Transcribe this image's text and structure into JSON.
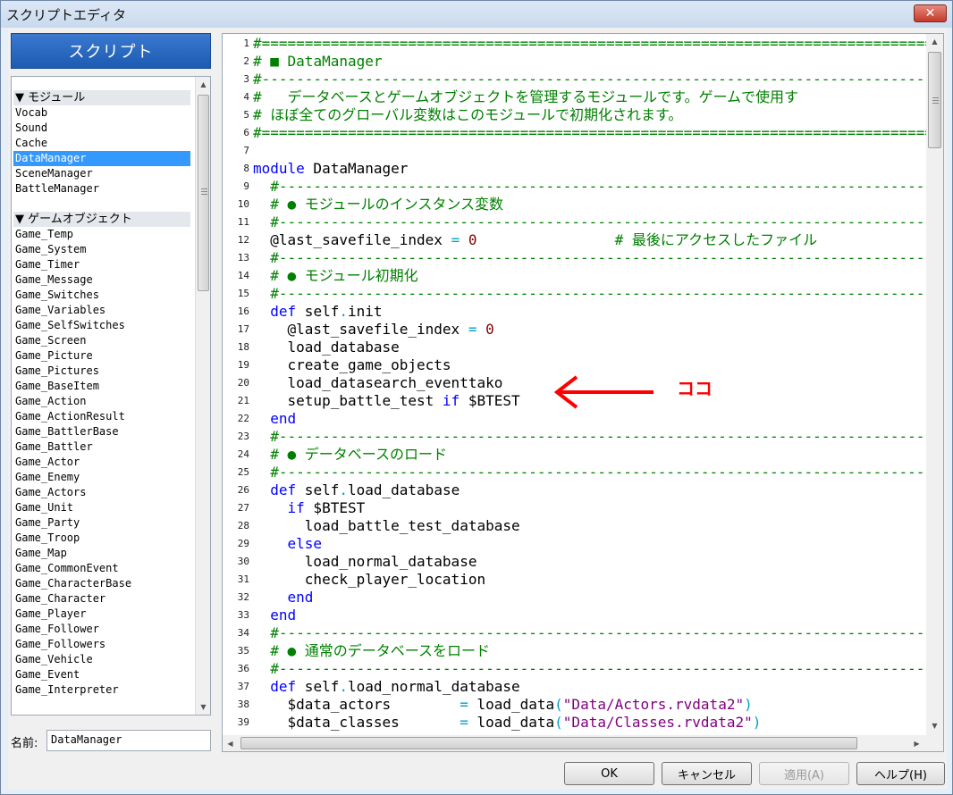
{
  "window": {
    "title": "スクリプトエディタ",
    "close_glyph": "✕"
  },
  "left_panel": {
    "header": "スクリプト",
    "items": [
      {
        "label": "▼ モジュール",
        "kind": "section"
      },
      {
        "label": "Vocab"
      },
      {
        "label": "Sound"
      },
      {
        "label": "Cache"
      },
      {
        "label": "DataManager",
        "selected": true
      },
      {
        "label": "SceneManager"
      },
      {
        "label": "BattleManager"
      },
      {
        "label": "",
        "kind": "blank"
      },
      {
        "label": "▼ ゲームオブジェクト",
        "kind": "section"
      },
      {
        "label": "Game_Temp"
      },
      {
        "label": "Game_System"
      },
      {
        "label": "Game_Timer"
      },
      {
        "label": "Game_Message"
      },
      {
        "label": "Game_Switches"
      },
      {
        "label": "Game_Variables"
      },
      {
        "label": "Game_SelfSwitches"
      },
      {
        "label": "Game_Screen"
      },
      {
        "label": "Game_Picture"
      },
      {
        "label": "Game_Pictures"
      },
      {
        "label": "Game_BaseItem"
      },
      {
        "label": "Game_Action"
      },
      {
        "label": "Game_ActionResult"
      },
      {
        "label": "Game_BattlerBase"
      },
      {
        "label": "Game_Battler"
      },
      {
        "label": "Game_Actor"
      },
      {
        "label": "Game_Enemy"
      },
      {
        "label": "Game_Actors"
      },
      {
        "label": "Game_Unit"
      },
      {
        "label": "Game_Party"
      },
      {
        "label": "Game_Troop"
      },
      {
        "label": "Game_Map"
      },
      {
        "label": "Game_CommonEvent"
      },
      {
        "label": "Game_CharacterBase"
      },
      {
        "label": "Game_Character"
      },
      {
        "label": "Game_Player"
      },
      {
        "label": "Game_Follower"
      },
      {
        "label": "Game_Followers"
      },
      {
        "label": "Game_Vehicle"
      },
      {
        "label": "Game_Event"
      },
      {
        "label": "Game_Interpreter"
      }
    ],
    "name_label": "名前:",
    "name_value": "DataManager"
  },
  "editor": {
    "lines": [
      {
        "n": "1",
        "tokens": [
          [
            "comment",
            "#==============================================================================="
          ]
        ]
      },
      {
        "n": "2",
        "tokens": [
          [
            "comment",
            "# "
          ],
          [
            "square",
            "■"
          ],
          [
            "comment",
            " DataManager"
          ]
        ]
      },
      {
        "n": "3",
        "tokens": [
          [
            "comment",
            "#-------------------------------------------------------------------------------"
          ]
        ]
      },
      {
        "n": "4",
        "tokens": [
          [
            "comment",
            "#   データベースとゲームオブジェクトを管理するモジュールです。ゲームで使用す"
          ]
        ]
      },
      {
        "n": "5",
        "tokens": [
          [
            "comment",
            "# ほぼ全てのグローバル変数はこのモジュールで初期化されます。"
          ]
        ]
      },
      {
        "n": "6",
        "tokens": [
          [
            "comment",
            "#==============================================================================="
          ]
        ]
      },
      {
        "n": "7",
        "tokens": []
      },
      {
        "n": "8",
        "tokens": [
          [
            "keyword",
            "module"
          ],
          [
            "plain",
            " DataManager"
          ]
        ]
      },
      {
        "n": "9",
        "tokens": [
          [
            "comment",
            "  #-----------------------------------------------------------------------------"
          ]
        ]
      },
      {
        "n": "10",
        "tokens": [
          [
            "comment",
            "  # ● モジュールのインスタンス変数"
          ]
        ]
      },
      {
        "n": "11",
        "tokens": [
          [
            "comment",
            "  #-----------------------------------------------------------------------------"
          ]
        ]
      },
      {
        "n": "12",
        "tokens": [
          [
            "plain",
            "  @last_savefile_index "
          ],
          [
            "op",
            "="
          ],
          [
            "plain",
            " "
          ],
          [
            "number",
            "0"
          ],
          [
            "plain",
            "                "
          ],
          [
            "comment",
            "# 最後にアクセスしたファイル"
          ]
        ]
      },
      {
        "n": "13",
        "tokens": [
          [
            "comment",
            "  #-----------------------------------------------------------------------------"
          ]
        ]
      },
      {
        "n": "14",
        "tokens": [
          [
            "comment",
            "  # ● モジュール初期化"
          ]
        ]
      },
      {
        "n": "15",
        "tokens": [
          [
            "comment",
            "  #-----------------------------------------------------------------------------"
          ]
        ]
      },
      {
        "n": "16",
        "tokens": [
          [
            "keyword",
            "  def"
          ],
          [
            "plain",
            " self"
          ],
          [
            "op",
            "."
          ],
          [
            "plain",
            "init"
          ]
        ]
      },
      {
        "n": "17",
        "tokens": [
          [
            "plain",
            "    @last_savefile_index "
          ],
          [
            "op",
            "="
          ],
          [
            "plain",
            " "
          ],
          [
            "number",
            "0"
          ]
        ]
      },
      {
        "n": "18",
        "tokens": [
          [
            "plain",
            "    load_database"
          ]
        ]
      },
      {
        "n": "19",
        "tokens": [
          [
            "plain",
            "    create_game_objects"
          ]
        ]
      },
      {
        "n": "20",
        "tokens": [
          [
            "plain",
            "    load_datasearch_eventtako"
          ]
        ]
      },
      {
        "n": "21",
        "tokens": [
          [
            "plain",
            "    setup_battle_test "
          ],
          [
            "keyword",
            "if"
          ],
          [
            "plain",
            " $BTEST"
          ]
        ]
      },
      {
        "n": "22",
        "tokens": [
          [
            "keyword",
            "  end"
          ]
        ]
      },
      {
        "n": "23",
        "tokens": [
          [
            "comment",
            "  #-----------------------------------------------------------------------------"
          ]
        ]
      },
      {
        "n": "24",
        "tokens": [
          [
            "comment",
            "  # ● データベースのロード"
          ]
        ]
      },
      {
        "n": "25",
        "tokens": [
          [
            "comment",
            "  #-----------------------------------------------------------------------------"
          ]
        ]
      },
      {
        "n": "26",
        "tokens": [
          [
            "keyword",
            "  def"
          ],
          [
            "plain",
            " self"
          ],
          [
            "op",
            "."
          ],
          [
            "plain",
            "load_database"
          ]
        ]
      },
      {
        "n": "27",
        "tokens": [
          [
            "keyword",
            "    if"
          ],
          [
            "plain",
            " $BTEST"
          ]
        ]
      },
      {
        "n": "28",
        "tokens": [
          [
            "plain",
            "      load_battle_test_database"
          ]
        ]
      },
      {
        "n": "29",
        "tokens": [
          [
            "keyword",
            "    else"
          ]
        ]
      },
      {
        "n": "30",
        "tokens": [
          [
            "plain",
            "      load_normal_database"
          ]
        ]
      },
      {
        "n": "31",
        "tokens": [
          [
            "plain",
            "      check_player_location"
          ]
        ]
      },
      {
        "n": "32",
        "tokens": [
          [
            "keyword",
            "    end"
          ]
        ]
      },
      {
        "n": "33",
        "tokens": [
          [
            "keyword",
            "  end"
          ]
        ]
      },
      {
        "n": "34",
        "tokens": [
          [
            "comment",
            "  #-----------------------------------------------------------------------------"
          ]
        ]
      },
      {
        "n": "35",
        "tokens": [
          [
            "comment",
            "  # ● 通常のデータベースをロード"
          ]
        ]
      },
      {
        "n": "36",
        "tokens": [
          [
            "comment",
            "  #-----------------------------------------------------------------------------"
          ]
        ]
      },
      {
        "n": "37",
        "tokens": [
          [
            "keyword",
            "  def"
          ],
          [
            "plain",
            " self"
          ],
          [
            "op",
            "."
          ],
          [
            "plain",
            "load_normal_database"
          ]
        ]
      },
      {
        "n": "38",
        "tokens": [
          [
            "plain",
            "    $data_actors        "
          ],
          [
            "op",
            "="
          ],
          [
            "plain",
            " load_data"
          ],
          [
            "op",
            "("
          ],
          [
            "string",
            "\"Data/Actors.rvdata2\""
          ],
          [
            "op",
            ")"
          ]
        ]
      },
      {
        "n": "39",
        "tokens": [
          [
            "plain",
            "    $data_classes       "
          ],
          [
            "op",
            "="
          ],
          [
            "plain",
            " load_data"
          ],
          [
            "op",
            "("
          ],
          [
            "string",
            "\"Data/Classes.rvdata2\""
          ],
          [
            "op",
            ")"
          ]
        ]
      }
    ]
  },
  "annotation": {
    "text": "ココ",
    "color": "#ff0000"
  },
  "buttons": {
    "ok": "OK",
    "cancel": "キャンセル",
    "apply": "適用(A)",
    "help": "ヘルプ(H)"
  },
  "colors": {
    "selection": "#3399ff",
    "header": "#1d5bb3",
    "comment": "#008000",
    "keyword": "#0000ff"
  }
}
